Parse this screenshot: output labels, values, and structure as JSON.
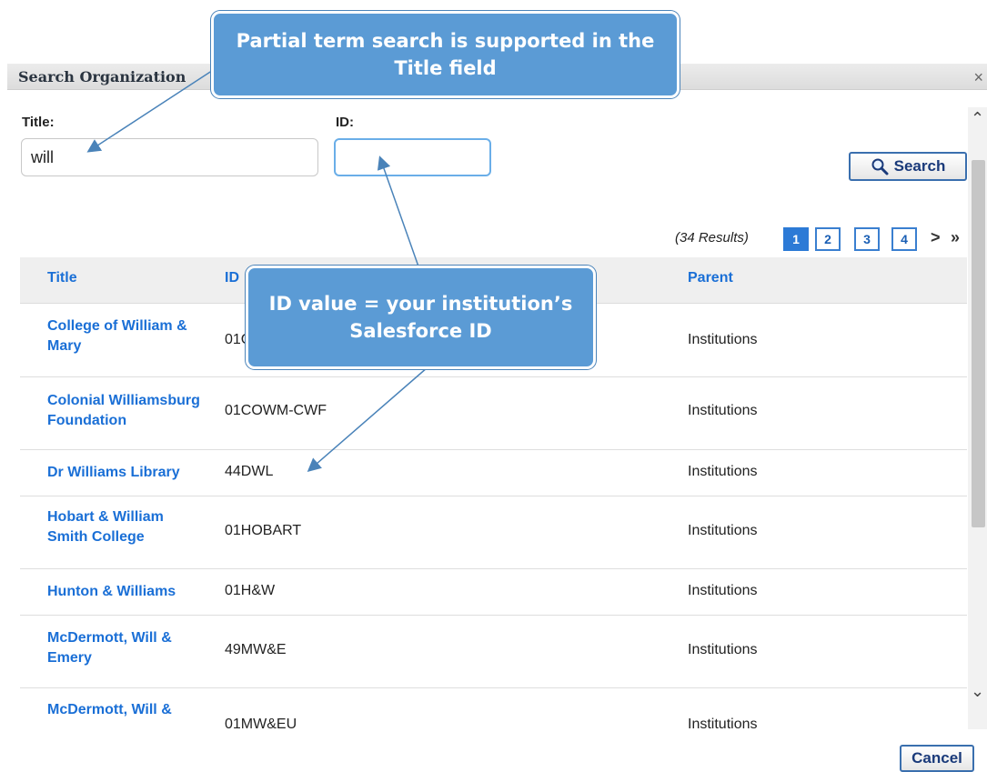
{
  "dialog": {
    "title": "Search Organization",
    "close_glyph": "×"
  },
  "form": {
    "title_label": "Title:",
    "title_value": "will",
    "id_label": "ID:",
    "id_value": "",
    "search_label": "Search"
  },
  "pagination": {
    "results_text": "(34 Results)",
    "pages": [
      "1",
      "2",
      "3",
      "4"
    ],
    "current_page": "1",
    "next_glyph": ">",
    "last_glyph": "»"
  },
  "table": {
    "columns": {
      "title": "Title",
      "id": "ID",
      "parent": "Parent"
    },
    "rows": [
      {
        "title": "College of William & Mary",
        "id": "01CWM",
        "parent": "Institutions"
      },
      {
        "title": "Colonial Williamsburg Foundation",
        "id": "01COWM-CWF",
        "parent": "Institutions"
      },
      {
        "title": "Dr Williams Library",
        "id": "44DWL",
        "parent": "Institutions"
      },
      {
        "title": "Hobart & William Smith College",
        "id": "01HOBART",
        "parent": "Institutions"
      },
      {
        "title": "Hunton & Williams",
        "id": "01H&W",
        "parent": "Institutions"
      },
      {
        "title": "McDermott, Will & Emery",
        "id": "49MW&E",
        "parent": "Institutions"
      },
      {
        "title": "McDermott, Will &",
        "id": "01MW&EU",
        "parent": "Institutions"
      }
    ]
  },
  "footer": {
    "cancel_label": "Cancel"
  },
  "callouts": {
    "top": "Partial term search is supported in the Title field",
    "middle": "ID value = your institution’s Salesforce ID"
  },
  "colors": {
    "callout": "#5b9bd5",
    "link": "#1a6fd6",
    "active_page": "#2c7ad6"
  }
}
